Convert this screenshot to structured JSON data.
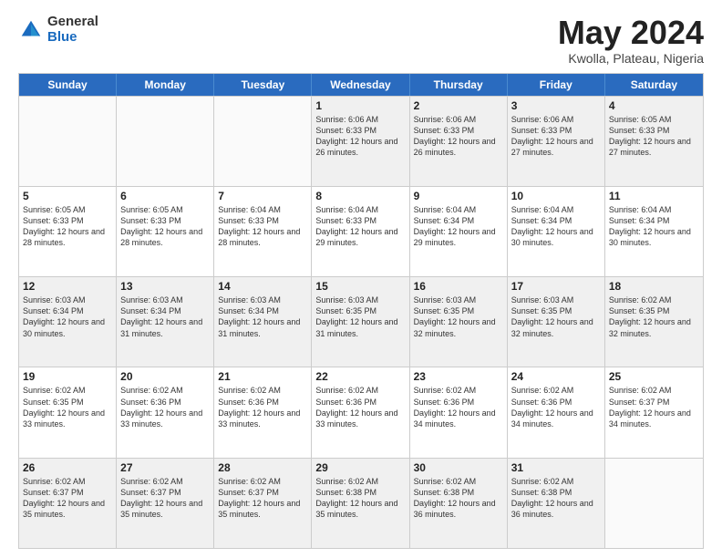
{
  "logo": {
    "general": "General",
    "blue": "Blue"
  },
  "header": {
    "month": "May 2024",
    "location": "Kwolla, Plateau, Nigeria"
  },
  "weekdays": [
    "Sunday",
    "Monday",
    "Tuesday",
    "Wednesday",
    "Thursday",
    "Friday",
    "Saturday"
  ],
  "weeks": [
    [
      {
        "day": "",
        "info": "",
        "empty": true
      },
      {
        "day": "",
        "info": "",
        "empty": true
      },
      {
        "day": "",
        "info": "",
        "empty": true
      },
      {
        "day": "1",
        "info": "Sunrise: 6:06 AM\nSunset: 6:33 PM\nDaylight: 12 hours\nand 26 minutes.",
        "empty": false
      },
      {
        "day": "2",
        "info": "Sunrise: 6:06 AM\nSunset: 6:33 PM\nDaylight: 12 hours\nand 26 minutes.",
        "empty": false
      },
      {
        "day": "3",
        "info": "Sunrise: 6:06 AM\nSunset: 6:33 PM\nDaylight: 12 hours\nand 27 minutes.",
        "empty": false
      },
      {
        "day": "4",
        "info": "Sunrise: 6:05 AM\nSunset: 6:33 PM\nDaylight: 12 hours\nand 27 minutes.",
        "empty": false
      }
    ],
    [
      {
        "day": "5",
        "info": "Sunrise: 6:05 AM\nSunset: 6:33 PM\nDaylight: 12 hours\nand 28 minutes.",
        "empty": false
      },
      {
        "day": "6",
        "info": "Sunrise: 6:05 AM\nSunset: 6:33 PM\nDaylight: 12 hours\nand 28 minutes.",
        "empty": false
      },
      {
        "day": "7",
        "info": "Sunrise: 6:04 AM\nSunset: 6:33 PM\nDaylight: 12 hours\nand 28 minutes.",
        "empty": false
      },
      {
        "day": "8",
        "info": "Sunrise: 6:04 AM\nSunset: 6:33 PM\nDaylight: 12 hours\nand 29 minutes.",
        "empty": false
      },
      {
        "day": "9",
        "info": "Sunrise: 6:04 AM\nSunset: 6:34 PM\nDaylight: 12 hours\nand 29 minutes.",
        "empty": false
      },
      {
        "day": "10",
        "info": "Sunrise: 6:04 AM\nSunset: 6:34 PM\nDaylight: 12 hours\nand 30 minutes.",
        "empty": false
      },
      {
        "day": "11",
        "info": "Sunrise: 6:04 AM\nSunset: 6:34 PM\nDaylight: 12 hours\nand 30 minutes.",
        "empty": false
      }
    ],
    [
      {
        "day": "12",
        "info": "Sunrise: 6:03 AM\nSunset: 6:34 PM\nDaylight: 12 hours\nand 30 minutes.",
        "empty": false
      },
      {
        "day": "13",
        "info": "Sunrise: 6:03 AM\nSunset: 6:34 PM\nDaylight: 12 hours\nand 31 minutes.",
        "empty": false
      },
      {
        "day": "14",
        "info": "Sunrise: 6:03 AM\nSunset: 6:34 PM\nDaylight: 12 hours\nand 31 minutes.",
        "empty": false
      },
      {
        "day": "15",
        "info": "Sunrise: 6:03 AM\nSunset: 6:35 PM\nDaylight: 12 hours\nand 31 minutes.",
        "empty": false
      },
      {
        "day": "16",
        "info": "Sunrise: 6:03 AM\nSunset: 6:35 PM\nDaylight: 12 hours\nand 32 minutes.",
        "empty": false
      },
      {
        "day": "17",
        "info": "Sunrise: 6:03 AM\nSunset: 6:35 PM\nDaylight: 12 hours\nand 32 minutes.",
        "empty": false
      },
      {
        "day": "18",
        "info": "Sunrise: 6:02 AM\nSunset: 6:35 PM\nDaylight: 12 hours\nand 32 minutes.",
        "empty": false
      }
    ],
    [
      {
        "day": "19",
        "info": "Sunrise: 6:02 AM\nSunset: 6:35 PM\nDaylight: 12 hours\nand 33 minutes.",
        "empty": false
      },
      {
        "day": "20",
        "info": "Sunrise: 6:02 AM\nSunset: 6:36 PM\nDaylight: 12 hours\nand 33 minutes.",
        "empty": false
      },
      {
        "day": "21",
        "info": "Sunrise: 6:02 AM\nSunset: 6:36 PM\nDaylight: 12 hours\nand 33 minutes.",
        "empty": false
      },
      {
        "day": "22",
        "info": "Sunrise: 6:02 AM\nSunset: 6:36 PM\nDaylight: 12 hours\nand 33 minutes.",
        "empty": false
      },
      {
        "day": "23",
        "info": "Sunrise: 6:02 AM\nSunset: 6:36 PM\nDaylight: 12 hours\nand 34 minutes.",
        "empty": false
      },
      {
        "day": "24",
        "info": "Sunrise: 6:02 AM\nSunset: 6:36 PM\nDaylight: 12 hours\nand 34 minutes.",
        "empty": false
      },
      {
        "day": "25",
        "info": "Sunrise: 6:02 AM\nSunset: 6:37 PM\nDaylight: 12 hours\nand 34 minutes.",
        "empty": false
      }
    ],
    [
      {
        "day": "26",
        "info": "Sunrise: 6:02 AM\nSunset: 6:37 PM\nDaylight: 12 hours\nand 35 minutes.",
        "empty": false
      },
      {
        "day": "27",
        "info": "Sunrise: 6:02 AM\nSunset: 6:37 PM\nDaylight: 12 hours\nand 35 minutes.",
        "empty": false
      },
      {
        "day": "28",
        "info": "Sunrise: 6:02 AM\nSunset: 6:37 PM\nDaylight: 12 hours\nand 35 minutes.",
        "empty": false
      },
      {
        "day": "29",
        "info": "Sunrise: 6:02 AM\nSunset: 6:38 PM\nDaylight: 12 hours\nand 35 minutes.",
        "empty": false
      },
      {
        "day": "30",
        "info": "Sunrise: 6:02 AM\nSunset: 6:38 PM\nDaylight: 12 hours\nand 36 minutes.",
        "empty": false
      },
      {
        "day": "31",
        "info": "Sunrise: 6:02 AM\nSunset: 6:38 PM\nDaylight: 12 hours\nand 36 minutes.",
        "empty": false
      },
      {
        "day": "",
        "info": "",
        "empty": true
      }
    ]
  ]
}
